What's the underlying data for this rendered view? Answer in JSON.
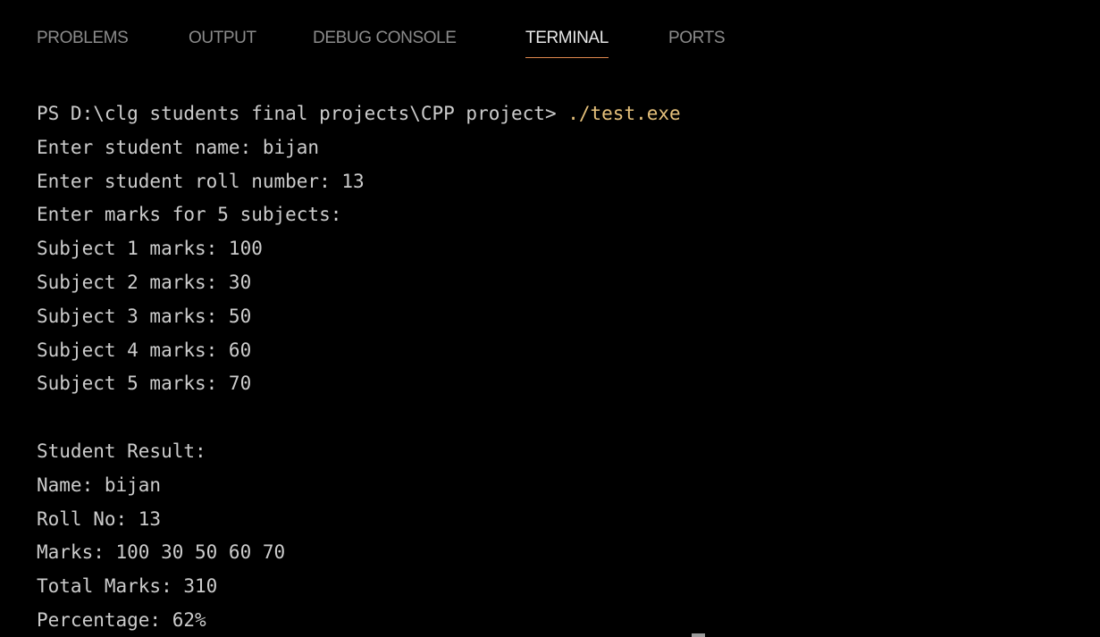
{
  "tabs": [
    {
      "label": "PROBLEMS"
    },
    {
      "label": "OUTPUT"
    },
    {
      "label": "DEBUG CONSOLE"
    },
    {
      "label": "TERMINAL"
    },
    {
      "label": "PORTS"
    }
  ],
  "active_tab": "TERMINAL",
  "colors": {
    "background": "#000000",
    "text": "#cccccc",
    "active_tab_underline": "#e0884f",
    "command": "#e5c07b",
    "inactive_tab": "#8b8b8b"
  },
  "terminal": {
    "prompt": "PS D:\\clg students final projects\\CPP project> ",
    "command": "./test.exe",
    "output_input": [
      "Enter student name: bijan",
      "Enter student roll number: 13",
      "Enter marks for 5 subjects:",
      "Subject 1 marks: 100",
      "Subject 2 marks: 30",
      "Subject 3 marks: 50",
      "Subject 4 marks: 60",
      "Subject 5 marks: 70"
    ],
    "result_lines": [
      "Student Result:",
      "Name: bijan",
      "Roll No: 13",
      "Marks: 100 30 50 60 70",
      "Total Marks: 310",
      "Percentage: 62%"
    ]
  }
}
